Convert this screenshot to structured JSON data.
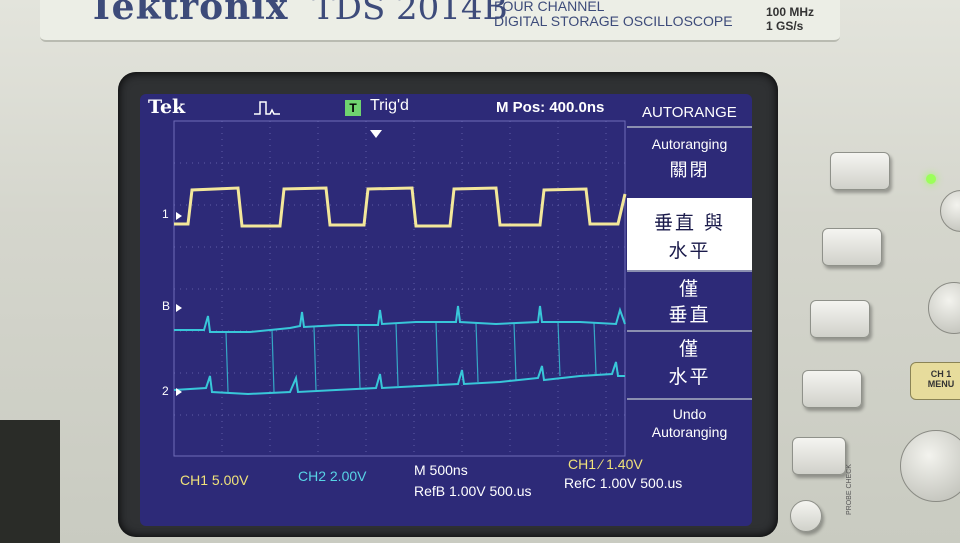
{
  "device": {
    "brand": "Tektronix",
    "model": "TDS 2014B",
    "description_line1": "FOUR CHANNEL",
    "description_line2": "DIGITAL STORAGE OSCILLOSCOPE",
    "bandwidth": "100 MHz",
    "sample_rate": "1 GS/s",
    "ch1_button_line1": "CH 1",
    "ch1_button_line2": "MENU",
    "probe_check": "PROBE CHECK"
  },
  "screen": {
    "logo": "Tek",
    "trigger_status": "Trig'd",
    "trigger_icon_label": "T",
    "menu_position": "M Pos: 400.0ns",
    "menu_title": "AUTORANGE",
    "marker_ch1": "1",
    "marker_refb": "B",
    "marker_ch2": "2",
    "menu": {
      "autoranging_label": "Autoranging",
      "autoranging_state": "關閉",
      "option_vert_horiz_line1": "垂直 與",
      "option_vert_horiz_line2": "水平",
      "option_vert_only_line1": "僅",
      "option_vert_only_line2": "垂直",
      "option_horiz_only_line1": "僅",
      "option_horiz_only_line2": "水平",
      "undo_line1": "Undo",
      "undo_line2": "Autoranging"
    },
    "status": {
      "ch1_scale": "CH1  5.00V",
      "ch2_scale": "CH2  2.00V",
      "timebase": "M 500ns",
      "trigger_level": "CH1 ∕ 1.40V",
      "refb": "RefB 1.00V 500.us",
      "refc": "RefC 1.00V 500.us"
    },
    "colors": {
      "screen_bg": "#2d2a78",
      "ch1_trace": "#f3e79a",
      "ch2_trace": "#38c7d9",
      "text": "#ffffff",
      "status_yellow": "#f0e27a",
      "status_cyan": "#58d4e6",
      "highlight_bg": "#ffffff"
    }
  },
  "controls": {
    "side_buttons": [
      "menu-button-1",
      "menu-button-2",
      "menu-button-3",
      "menu-button-4",
      "menu-button-5",
      "menu-button-6"
    ]
  }
}
